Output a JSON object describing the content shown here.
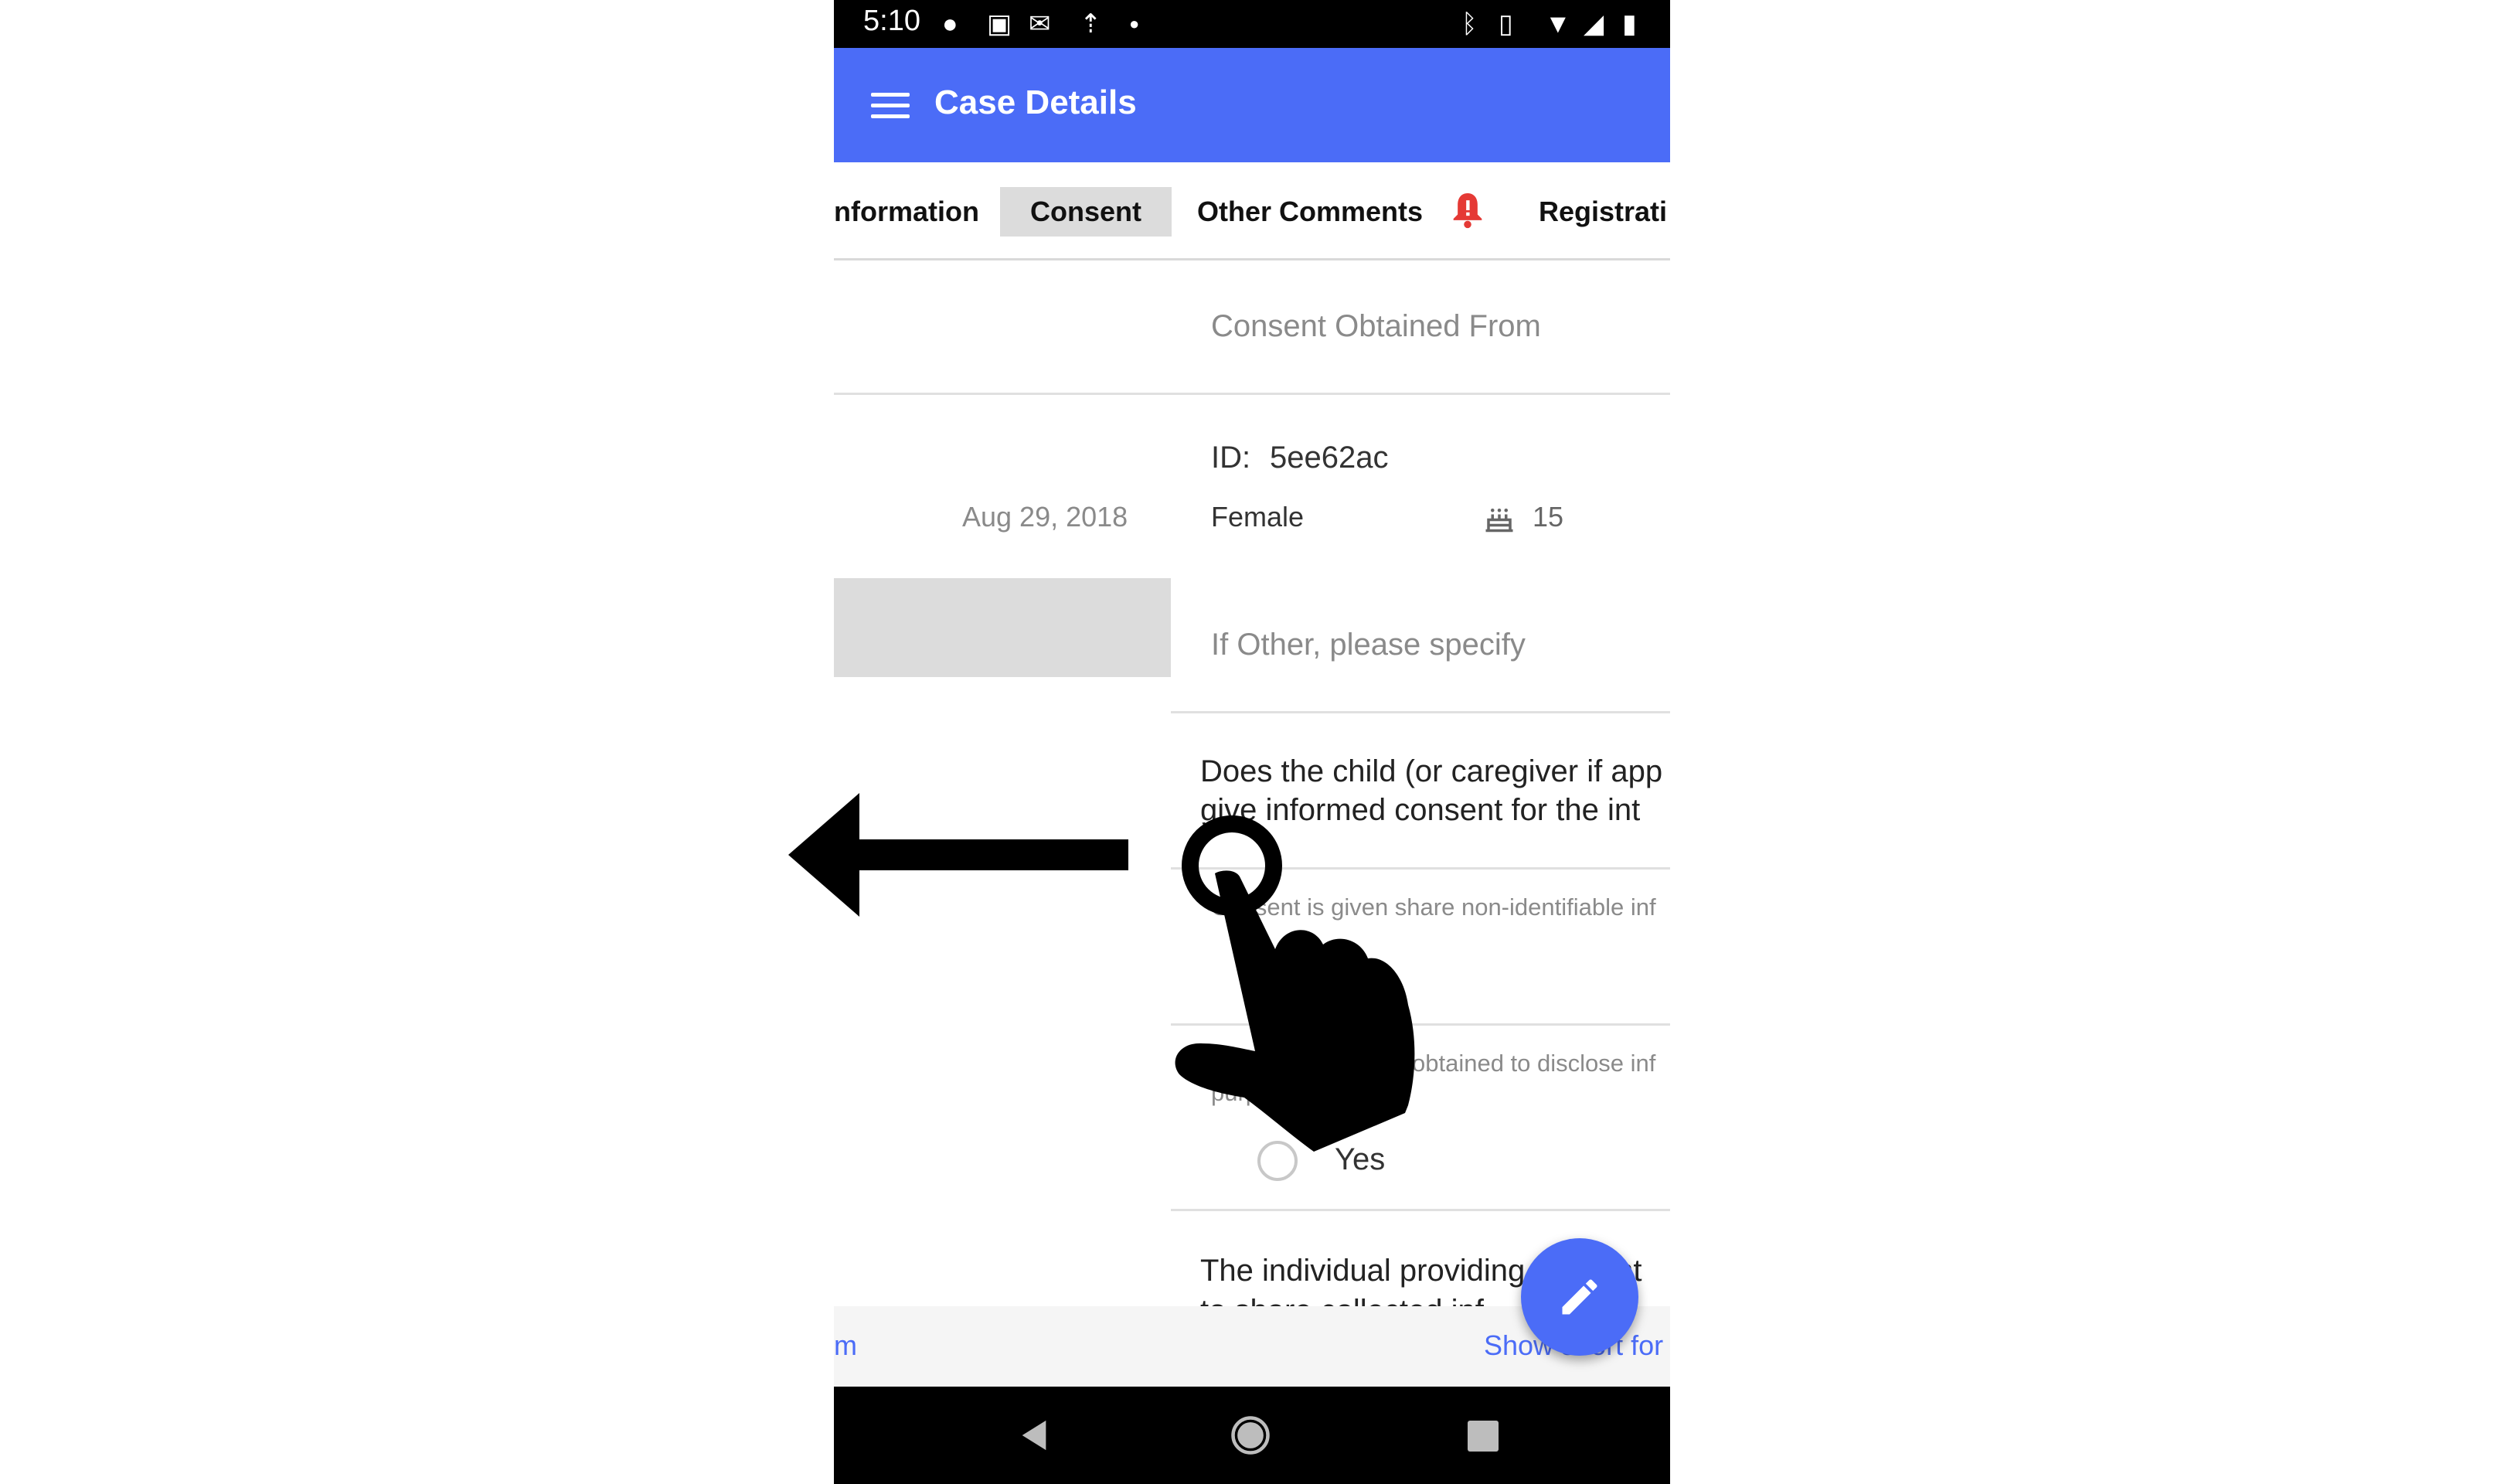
{
  "status_bar": {
    "time": "5:10"
  },
  "app_bar": {
    "title": "Case Details"
  },
  "tabs": [
    {
      "label": "nformation"
    },
    {
      "label": "Consent"
    },
    {
      "label": "Other Comments"
    },
    {
      "label": "Registrati"
    }
  ],
  "left_pane": {
    "date": "Aug 29, 2018"
  },
  "right_pane": {
    "consent_obtained_from": "Consent Obtained From",
    "id_label": "ID:",
    "id_value": "5ee62ac",
    "sex": "Female",
    "age": "15",
    "if_other_placeholder": "If Other, please specify",
    "question1_line1": "Does the child (or caregiver if app",
    "question1_line2": "give informed consent for the int",
    "question2": "Consent is given share non-identifiable inf",
    "question3_line1": "obtained to disclose inf",
    "question3_line2": "purp",
    "yes_label": "Yes",
    "question4_line1": "The individual providing consent",
    "question4_line2": "to share collected inf"
  },
  "bottom_strip": {
    "left_link": "m",
    "right_link": "Show short for"
  },
  "colors": {
    "app_bar": "#4b6cf7",
    "fab": "#4b6cf7",
    "bell": "#e53935",
    "link": "#4b6cf7"
  }
}
